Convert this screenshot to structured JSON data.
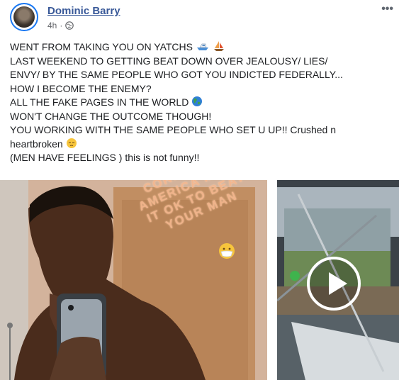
{
  "post": {
    "author": "Dominic Barry",
    "time": "4h",
    "separator": "·",
    "more": "•••",
    "lines": [
      "WENT FROM TAKING YOU ON YATCHS",
      "LAST WEEKEND TO GETTING BEAT DOWN OVER JEALOUSY/ LIES/",
      "ENVY/ BY THE SAME PEOPLE WHO GOT YOU INDICTED FEDERALLY...",
      "HOW I BECOME THE ENEMY?",
      "ALL THE FAKE PAGES IN THE WORLD",
      "WON'T CHANGE THE OUTCOME THOUGH!",
      "YOU WORKING WITH THE SAME PEOPLE WHO SET U UP!! Crushed n",
      "heartbroken",
      "(MEN HAVE FEELINGS ) this is not funny!!"
    ]
  },
  "photo": {
    "overlay_text": "CORPORATE\nAMERICA MADE\nIT OK TO BEAT\nYOUR MAN"
  },
  "icons": {
    "globe": "globe-icon",
    "more": "more-options-icon",
    "boat": "speedboat-emoji",
    "sailboat": "sailboat-emoji",
    "earth": "earth-emoji",
    "pensive": "pensive-face-emoji",
    "mask": "mask-face-emoji",
    "play": "play-icon"
  },
  "colors": {
    "author_link": "#385898",
    "meta_text": "#65676b",
    "overlay_text": "#f6b88f",
    "avatar_ring": "#1877f2"
  }
}
